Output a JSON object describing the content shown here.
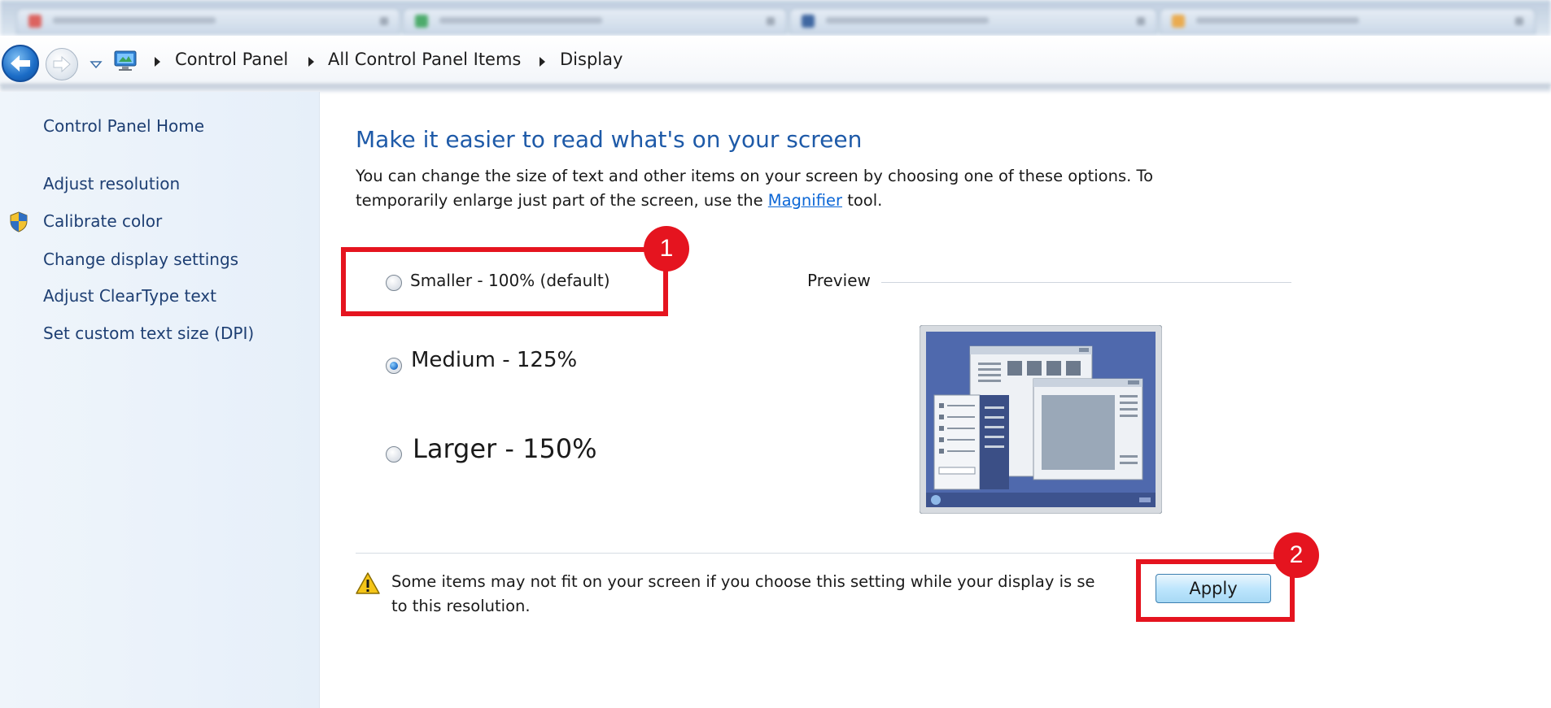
{
  "breadcrumb": {
    "items": [
      "Control Panel",
      "All Control Panel Items",
      "Display"
    ]
  },
  "sidebar": {
    "items": [
      {
        "label": "Control Panel Home"
      },
      {
        "label": "Adjust resolution"
      },
      {
        "label": "Calibrate color",
        "icon": "uac-shield-icon"
      },
      {
        "label": "Change display settings"
      },
      {
        "label": "Adjust ClearType text"
      },
      {
        "label": "Set custom text size (DPI)"
      }
    ]
  },
  "main": {
    "heading": "Make it easier to read what's on your screen",
    "description_line1": "You can change the size of text and other items on your screen by choosing one of these options. To",
    "description_line2_before": "temporarily enlarge just part of the screen, use the",
    "description_link": "Magnifier",
    "description_line2_after": "tool.",
    "options": [
      {
        "label": "Smaller - 100% (default)",
        "checked": false
      },
      {
        "label": "Medium - 125%",
        "checked": true
      },
      {
        "label": "Larger - 150%",
        "checked": false
      }
    ],
    "preview_label": "Preview",
    "warning_line1": "Some items may not fit on your screen if you choose this setting while your display is se",
    "warning_line2": "to this resolution.",
    "apply_label": "Apply"
  },
  "annotations": [
    {
      "number": "1",
      "target": "Smaller - 100% (default)"
    },
    {
      "number": "2",
      "target": "Apply"
    }
  ],
  "colors": {
    "annotation_red": "#e5141f",
    "heading_blue": "#1e5aa8",
    "link_blue": "#0b66d6",
    "sidebar_link": "#1e3f73"
  }
}
